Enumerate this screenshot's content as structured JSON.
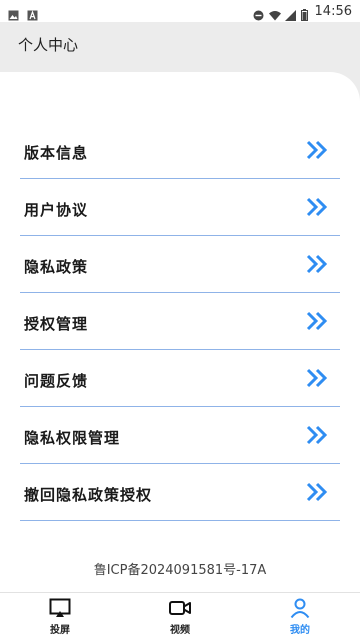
{
  "status_bar": {
    "time": "14:56",
    "left_icons": [
      "image-icon",
      "a-notification-icon"
    ],
    "right_icons": [
      "dnd-icon",
      "wifi-icon",
      "signal-icon",
      "battery-icon"
    ]
  },
  "header": {
    "title": "个人中心"
  },
  "menu": {
    "items": [
      {
        "label": "版本信息"
      },
      {
        "label": "用户协议"
      },
      {
        "label": "隐私政策"
      },
      {
        "label": "授权管理"
      },
      {
        "label": "问题反馈"
      },
      {
        "label": "隐私权限管理"
      },
      {
        "label": "撤回隐私政策授权"
      }
    ]
  },
  "footer": {
    "icp": "鲁ICP备2024091581号-17A"
  },
  "bottom_nav": {
    "items": [
      {
        "label": "投屏",
        "icon": "screen-cast-icon",
        "active": false
      },
      {
        "label": "视频",
        "icon": "video-camera-icon",
        "active": false
      },
      {
        "label": "我的",
        "icon": "profile-icon",
        "active": true
      }
    ]
  },
  "colors": {
    "accent": "#2f8df2",
    "divider": "#8fb3e8",
    "background": "#ececec"
  }
}
